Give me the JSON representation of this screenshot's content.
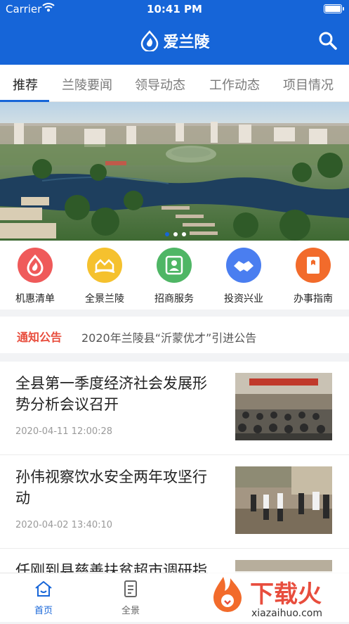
{
  "status": {
    "carrier": "Carrier",
    "time": "10:41 PM",
    "battery_level": 0.9
  },
  "header": {
    "title": "爱兰陵",
    "search_icon": "search-icon",
    "logo_icon": "flame-drop-icon"
  },
  "tabs": [
    {
      "label": "推荐",
      "active": true
    },
    {
      "label": "兰陵要闻",
      "active": false
    },
    {
      "label": "领导动态",
      "active": false
    },
    {
      "label": "工作动态",
      "active": false
    },
    {
      "label": "项目情况",
      "active": false
    }
  ],
  "banner": {
    "slide_count": 3,
    "current_slide": 1
  },
  "quick_links": [
    {
      "label": "机惠清单",
      "icon": "flame-icon",
      "color": "#ef5a5a"
    },
    {
      "label": "全景兰陵",
      "icon": "panorama-icon",
      "color": "#f5c12e"
    },
    {
      "label": "招商服务",
      "icon": "person-card-icon",
      "color": "#4fb665"
    },
    {
      "label": "投资兴业",
      "icon": "handshake-icon",
      "color": "#4a7ef0"
    },
    {
      "label": "办事指南",
      "icon": "guide-icon",
      "color": "#f26b2b"
    }
  ],
  "notice": {
    "tag": "通知公告",
    "text": "2020年兰陵县“沂蒙优才”引进公告"
  },
  "news": [
    {
      "title": "全县第一季度经济社会发展形势分析会议召开",
      "time": "2020-04-11 12:00:28"
    },
    {
      "title": "孙伟视察饮水安全两年攻坚行动",
      "time": "2020-04-02 13:40:10"
    },
    {
      "title": "任刚到县慈善扶贫超市调研指导",
      "time": ""
    }
  ],
  "bottom_tabs": [
    {
      "label": "首页",
      "icon": "home-icon",
      "active": true
    },
    {
      "label": "全景",
      "icon": "document-icon",
      "active": false
    }
  ],
  "watermark": {
    "text": "下载火",
    "url": "xiazaihuo.com"
  },
  "colors": {
    "primary": "#1665d8",
    "notice": "#e84d3d"
  }
}
